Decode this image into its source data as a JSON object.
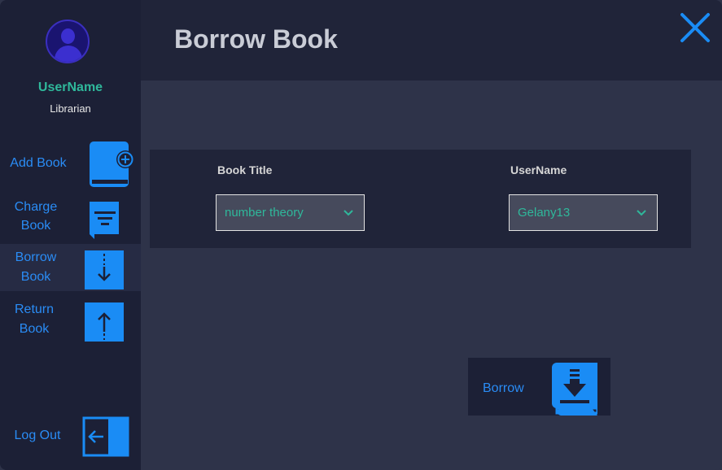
{
  "window": {
    "title": "Borrow Book"
  },
  "user": {
    "name": "UserName",
    "role": "Librarian"
  },
  "sidebar": {
    "items": [
      {
        "label": "Add Book",
        "icon": "book-add-icon"
      },
      {
        "label_line1": "Charge",
        "label_line2": "Book",
        "icon": "book-charge-icon"
      },
      {
        "label_line1": "Borrow",
        "label_line2": "Book",
        "icon": "book-borrow-icon",
        "active": true
      },
      {
        "label_line1": "Return",
        "label_line2": "Book",
        "icon": "book-return-icon"
      }
    ],
    "logout": {
      "label": "Log Out",
      "icon": "logout-icon"
    }
  },
  "form": {
    "book_title": {
      "label": "Book Title",
      "value": "number theory"
    },
    "username": {
      "label": "UserName",
      "value": "Gelany13"
    }
  },
  "actions": {
    "borrow_label": "Borrow"
  },
  "colors": {
    "accent": "#2a8cf5",
    "teal": "#2fb89b",
    "sidebar": "#1c2036",
    "panel": "#202439",
    "background": "#2e3349"
  }
}
